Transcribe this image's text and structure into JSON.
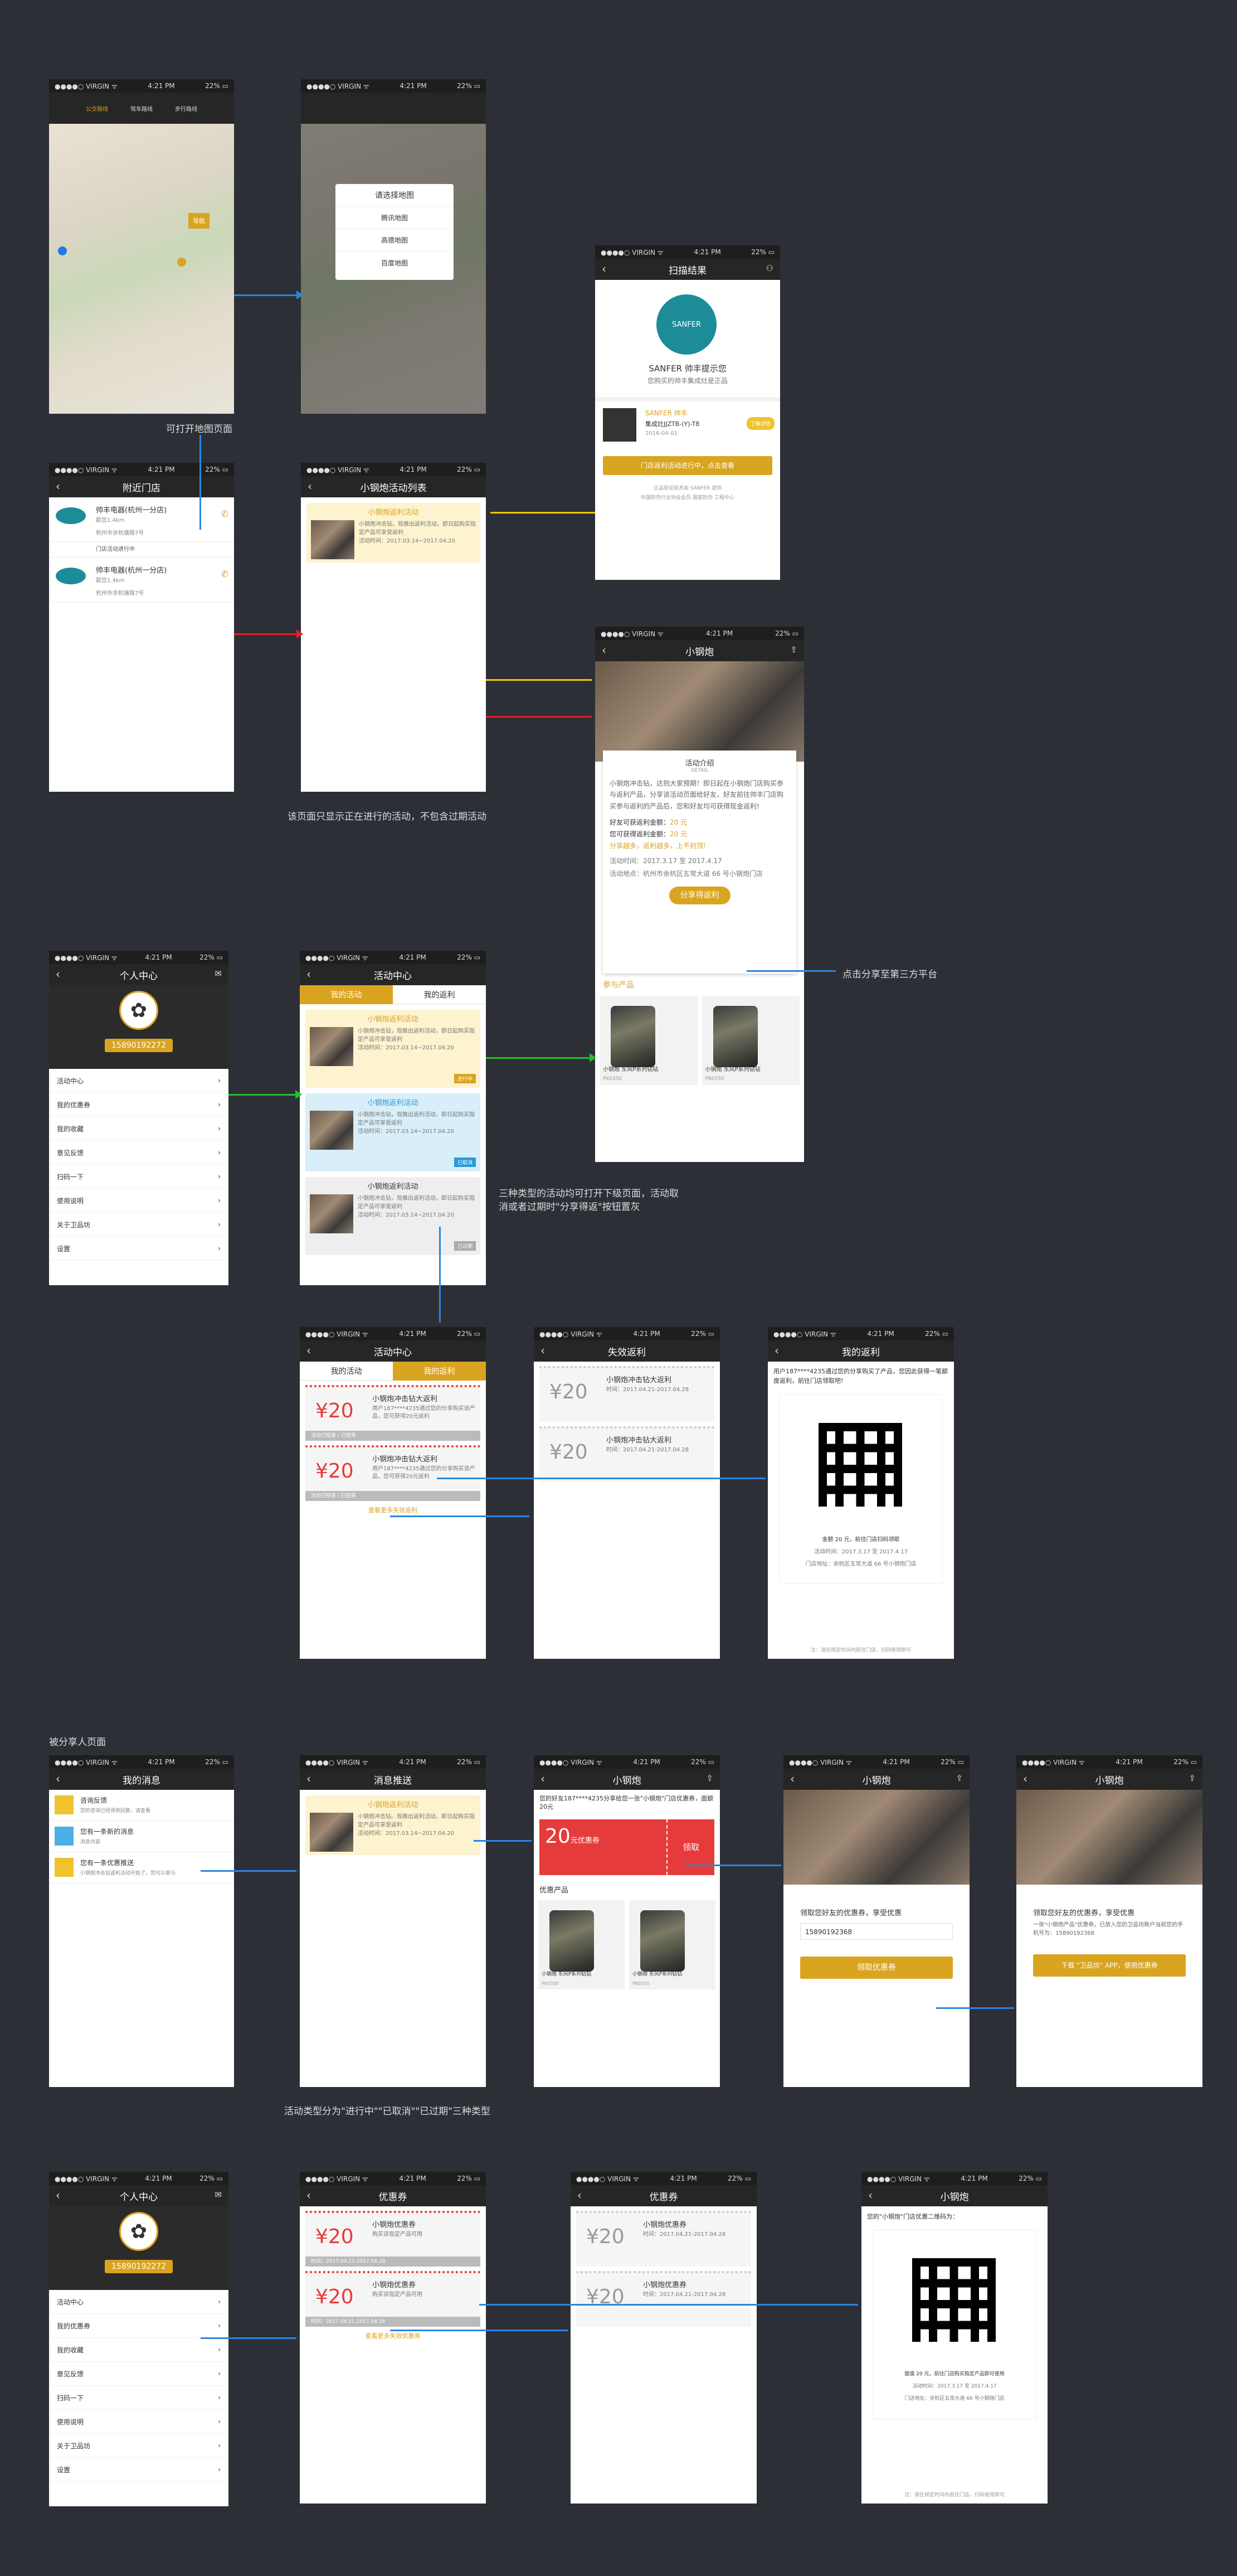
{
  "status": {
    "carrier": "●●●●○ VIRGIN ᯤ",
    "time": "4:21 PM",
    "battery": "22% ▭"
  },
  "notes": {
    "map_open": "可打开地图页面",
    "list_only": "该页面只显示正在进行的活动，不包含过期活动",
    "share_click": "点击分享至第三方平台",
    "three_types": "三种类型的活动均可打开下级页面，活动取\n消或者过期时\"分享得返\"按钮置灰",
    "shared_page": "被分享人页面",
    "types_note": "活动类型分为\"进行中\"\"已取消\"\"已过期\"三种类型"
  },
  "map": {
    "modes": [
      "公交路线",
      "驾车路线",
      "步行路线"
    ],
    "choose_title": "请选择地图",
    "choices": [
      "腾讯地图",
      "高德地图",
      "百度地图"
    ],
    "go": "导航"
  },
  "scan": {
    "title": "扫描结果",
    "brand": "SANFER 帅丰提示您",
    "genuine": "您购买的帅丰集成灶是正品",
    "product_name": "SANFER 帅丰",
    "product_model": "集成灶JJZTB-(Y)-T8",
    "date": "2016-04-01",
    "goods_btn": "了解详情",
    "activity_btn": "门店返利活动进行中，点击查看",
    "footer1": "正品验证技术由 SANFER 提供",
    "footer2": "中国防伪行业协会会员 国家防伪 工程中心"
  },
  "nearby": {
    "title": "附近门店",
    "stores": [
      {
        "name": "帅丰电器(杭州一分店)",
        "dist": "距您1.4km",
        "addr": "杭州市余杭塘路7号",
        "promo": "门店活动进行中"
      },
      {
        "name": "帅丰电器(杭州一分店)",
        "dist": "距您1.4km",
        "addr": "杭州市余杭塘路7号"
      }
    ]
  },
  "actlist": {
    "title": "小钢炮活动列表",
    "item": {
      "title": "小钢炮返利活动",
      "desc": "小钢炮冲击钻。现推出返利活动，即日起购买指定产品可享受返利",
      "time": "活动时间：2017.03.14~2017.04.20"
    }
  },
  "detail": {
    "title": "小钢炮",
    "intro": "活动介绍",
    "intro_en": "DETAIL",
    "body": "小钢炮冲击钻，达到大家预期！即日起在小钢炮门店购买参与返利产品，分享该活动页面给好友，好友前往帅丰门店购买参与返利的产品后，您和好友均可获得现金返利!",
    "r1": "好友可获返利金额：",
    "r1v": "20 元",
    "r2": "您可获得返利金额：",
    "r2v": "20 元",
    "r3": "分享越多，返利越多，上不封顶!",
    "time": "活动时间：2017.3.17 至 2017.4.17",
    "addr": "活动地点：杭州市余杭区五常大道 66 号小钢炮门店",
    "share": "分享得返利",
    "products": "参与产品",
    "p1": "小钢炮 东风P系列钻钻",
    "p1c": "P60350",
    "p2": "小钢炮 东风P系列钻钻",
    "p2c": "P60350"
  },
  "profile": {
    "title": "个人中心",
    "phone": "15890192272",
    "menu": [
      "活动中心",
      "我的优惠券",
      "我的收藏",
      "意见反馈",
      "扫码一下",
      "使用说明",
      "关于卫品坊",
      "设置"
    ]
  },
  "center": {
    "title": "活动中心",
    "tab1": "我的活动",
    "tab2": "我的返利",
    "items": [
      {
        "title": "小钢炮返利活动",
        "status": "进行中"
      },
      {
        "title": "小钢炮返利活动",
        "status": "已取消"
      },
      {
        "title": "小钢炮返利活动",
        "status": "已过期"
      }
    ],
    "desc": "小钢炮冲击钻，现推出返利活动，即日起购买指定产品可享受返利",
    "time": "活动时间：2017.03.14~2017.04.20"
  },
  "rebate": {
    "title": "活动中心",
    "tab1": "我的活动",
    "tab2": "我的返利",
    "items": [
      {
        "amt": "20",
        "title": "小钢炮冲击钻大返利",
        "desc": "用户187****4235通过您的分享购买该产品，您可获得20元返利",
        "time": "时间：2017.04.21-2017.04.28",
        "exp": "活动已结束 / 已结束"
      },
      {
        "amt": "20",
        "title": "小钢炮冲击钻大返利",
        "desc": "用户187****4235通过您的分享购买该产品，您可获得20元返利",
        "time": "时间：2017.04.21-2017.04.28",
        "exp": "活动已结束 / 已结束"
      }
    ],
    "more": "查看更多失效返利"
  },
  "invalid": {
    "title": "失效返利",
    "items": [
      {
        "amt": "20",
        "title": "小钢炮冲击钻大返利",
        "time": "时间：2017.04.21-2017.04.28"
      },
      {
        "amt": "20",
        "title": "小钢炮冲击钻大返利",
        "time": "时间：2017.04.21-2017.04.28"
      }
    ]
  },
  "myrebate": {
    "title": "我的返利",
    "text": "用户187****4235通过您的分享购买了产品，您因此获得一笔额度返利，前往门店领取吧!",
    "line1": "金额 20 元，前往门店扫码领取",
    "line2": "活动时间：2017.3.17 至 2017.4.17",
    "line3": "门店地址：余杭区五常大道 66 号小钢炮门店",
    "foot": "注：请在规定时间内前往门店，扫码使用即可"
  },
  "messages": {
    "title": "我的消息",
    "items": [
      {
        "t": "咨询反馈",
        "d": "您的咨询已经得到回复，请查看"
      },
      {
        "t": "您有一条新的消息",
        "d": "消息内容"
      },
      {
        "t": "您有一条优惠推送",
        "d": "小钢炮冲击钻返利活动开始了，您可以参与"
      }
    ]
  },
  "push": {
    "title": "消息推送"
  },
  "coupon_share": {
    "title": "小钢炮",
    "text": "您的好友187****4235分享给您一张\"小钢炮\"门店优惠券，面额20元",
    "amt": "20",
    "unit": "元优惠券",
    "take": "领取",
    "products": "优惠产品"
  },
  "claim": {
    "title": "小钢炮",
    "lead": "领取您好友的优惠券，享受优惠",
    "phone": "15890192368",
    "btn": "领取优惠券"
  },
  "claimed": {
    "title": "小钢炮",
    "lead": "领取您好友的优惠券，享受优惠",
    "sub": "一张\"小钢炮产品\"优惠券，已放入您的卫品坊账户当前您的手机号为：15890192368",
    "btn": "下载 \"卫品坊\" APP，使用优惠券"
  },
  "coupons": {
    "title": "优惠券",
    "items": [
      {
        "amt": "20",
        "title": "小钢炮优惠券",
        "desc": "购买该指定产品可用",
        "time": "时间：2017.04.21-2017.04.28"
      },
      {
        "amt": "20",
        "title": "小钢炮优惠券",
        "desc": "购买该指定产品可用",
        "time": "时间：2017.04.21-2017.04.28"
      }
    ],
    "more": "查看更多失效优惠券"
  },
  "coupon_qr": {
    "title": "小钢炮",
    "text": "您的\"小钢炮\"门店优惠二维码为：",
    "line1": "面值 20 元，前往门店购买指定产品即可使用",
    "line2": "活动时间：2017.3.17 至 2017.4.17",
    "line3": "门店地址：余杭区五常大道 66 号小钢炮门店",
    "foot": "注：请在规定时间内前往门店，扫码使用即可"
  }
}
